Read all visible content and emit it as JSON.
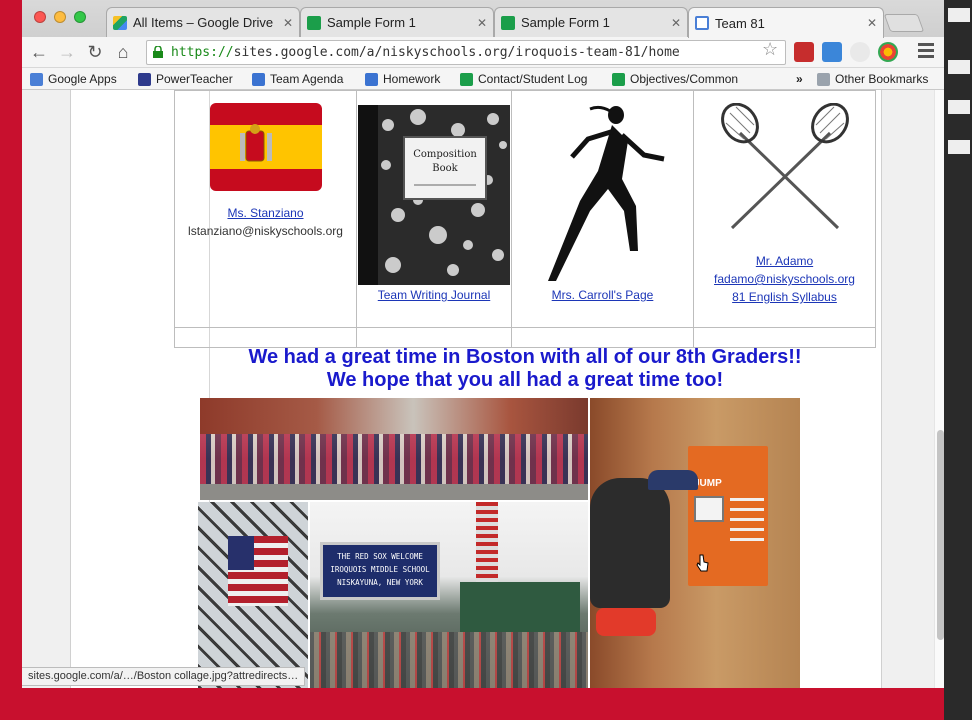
{
  "browser": {
    "tabs": [
      {
        "label": "All Items – Google Drive",
        "icon": "drive-icon",
        "active": false
      },
      {
        "label": "Sample Form 1",
        "icon": "forms-icon",
        "active": false
      },
      {
        "label": "Sample Form 1",
        "icon": "forms-icon",
        "active": false
      },
      {
        "label": "Team 81",
        "icon": "sites-icon",
        "active": true
      }
    ],
    "url_scheme": "https://",
    "url_rest": "sites.google.com/a/niskyschools.org/iroquois-team-81/home",
    "bookmarks": [
      {
        "label": "Google Apps",
        "icon": "google-apps-icon",
        "color": "#4a7fd6"
      },
      {
        "label": "PowerTeacher",
        "icon": "powerteacher-icon",
        "color": "#2e3a8c"
      },
      {
        "label": "Team Agenda",
        "icon": "docs-icon",
        "color": "#3b73d1"
      },
      {
        "label": "Homework",
        "icon": "docs-icon",
        "color": "#3b73d1"
      },
      {
        "label": "Contact/Student Log",
        "icon": "sheets-icon",
        "color": "#1b9e4a"
      },
      {
        "label": "Objectives/Common",
        "icon": "sheets-icon",
        "color": "#1b9e4a"
      }
    ],
    "overflow_chevron": "»",
    "other_bookmarks": "Other Bookmarks",
    "status_url": "sites.google.com/a/…/Boston collage.jpg?attredirects…"
  },
  "teachers": [
    {
      "name": "Ms. Stanziano",
      "email": "lstanziano@niskyschools.org",
      "image": "spain-flag",
      "extra": []
    },
    {
      "name": "Team Writing Journal",
      "email": "",
      "image": "composition-book",
      "extra": [],
      "book_title": "Composition Book"
    },
    {
      "name": "Mrs. Carroll's Page",
      "email": "",
      "image": "runner",
      "extra": []
    },
    {
      "name": "Mr. Adamo",
      "email": "fadamo@niskyschools.org",
      "image": "lacrosse-sticks",
      "extra": [
        "81 English Syllabus"
      ]
    }
  ],
  "headline": {
    "line1": "We had a great time in Boston with all of our 8th Graders!!",
    "line2": "We hope that you all had a great time too!"
  },
  "photos": {
    "sign_line1": "THE RED SOX WELCOME",
    "sign_line2": "IROQUOIS MIDDLE SCHOOL",
    "sign_line3": "NISKAYUNA, NEW YORK",
    "museum_label": "JUMP"
  }
}
